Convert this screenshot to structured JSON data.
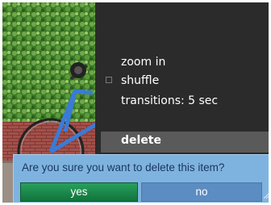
{
  "menu": {
    "items": [
      {
        "label": "zoom in"
      },
      {
        "label": "shuffle"
      },
      {
        "label": "transitions: 5 sec"
      }
    ],
    "delete_label": "delete"
  },
  "dialog": {
    "message": "Are you sure you want to delete this item?",
    "yes_label": "yes",
    "no_label": "no"
  },
  "photo": {
    "icon": "photo-thumbnail",
    "colors": {
      "hedge": "#3f7d2a",
      "wall": "#a8504a",
      "pavement": "#9b8f86"
    }
  }
}
